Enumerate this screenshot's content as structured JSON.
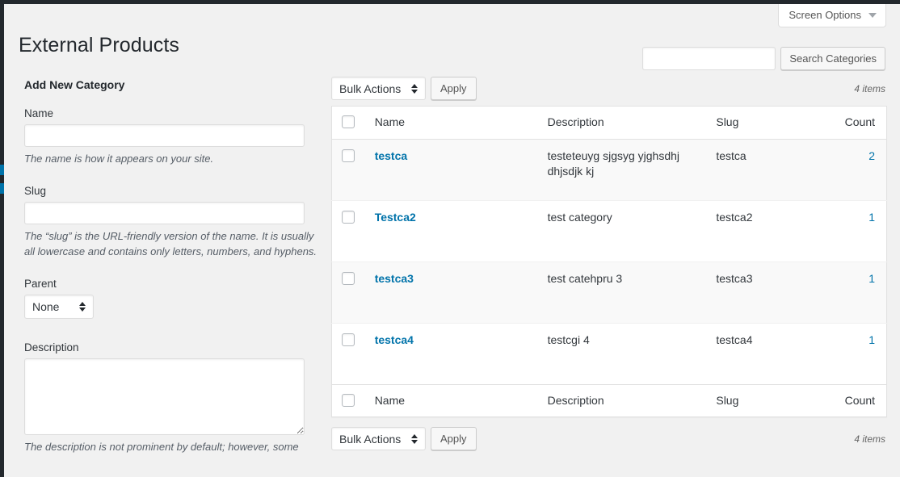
{
  "window": {
    "accent_dark": "#23282d",
    "accent_blue": "#0073aa",
    "page_background": "#f1f1f1"
  },
  "screen_options": {
    "label": "Screen Options",
    "caret_icon": "chevron-down-icon"
  },
  "header": {
    "title": "External Products"
  },
  "search": {
    "value": "",
    "placeholder": "",
    "submit_label": "Search Categories"
  },
  "form": {
    "heading": "Add New Category",
    "name": {
      "label": "Name",
      "value": "",
      "placeholder": "",
      "help": "The name is how it appears on your site."
    },
    "slug": {
      "label": "Slug",
      "value": "",
      "placeholder": "",
      "help": "The “slug” is the URL-friendly version of the name. It is usually all lowercase and contains only letters, numbers, and hyphens."
    },
    "parent": {
      "label": "Parent",
      "selected": "None",
      "options": [
        "None"
      ]
    },
    "description": {
      "label": "Description",
      "value": "",
      "placeholder": "",
      "help": "The description is not prominent by default; however, some"
    }
  },
  "tablenav_top": {
    "bulk_selected": "Bulk Actions",
    "bulk_options": [
      "Bulk Actions"
    ],
    "apply_label": "Apply",
    "displaying_num": "4 items"
  },
  "tablenav_bottom": {
    "bulk_selected": "Bulk Actions",
    "bulk_options": [
      "Bulk Actions"
    ],
    "apply_label": "Apply",
    "displaying_num": "4 items"
  },
  "table": {
    "columns": {
      "name": "Name",
      "description": "Description",
      "slug": "Slug",
      "count": "Count"
    },
    "rows": [
      {
        "name": "testca",
        "description": "testeteuyg sjgsyg yjghsdhj dhjsdjk kj",
        "slug": "testca",
        "count": "2",
        "checked": false
      },
      {
        "name": "Testca2",
        "description": "test category",
        "slug": "testca2",
        "count": "1",
        "checked": false
      },
      {
        "name": "testca3",
        "description": "test catehpru 3",
        "slug": "testca3",
        "count": "1",
        "checked": false
      },
      {
        "name": "testca4",
        "description": "testcgi 4",
        "slug": "testca4",
        "count": "1",
        "checked": false
      }
    ]
  }
}
